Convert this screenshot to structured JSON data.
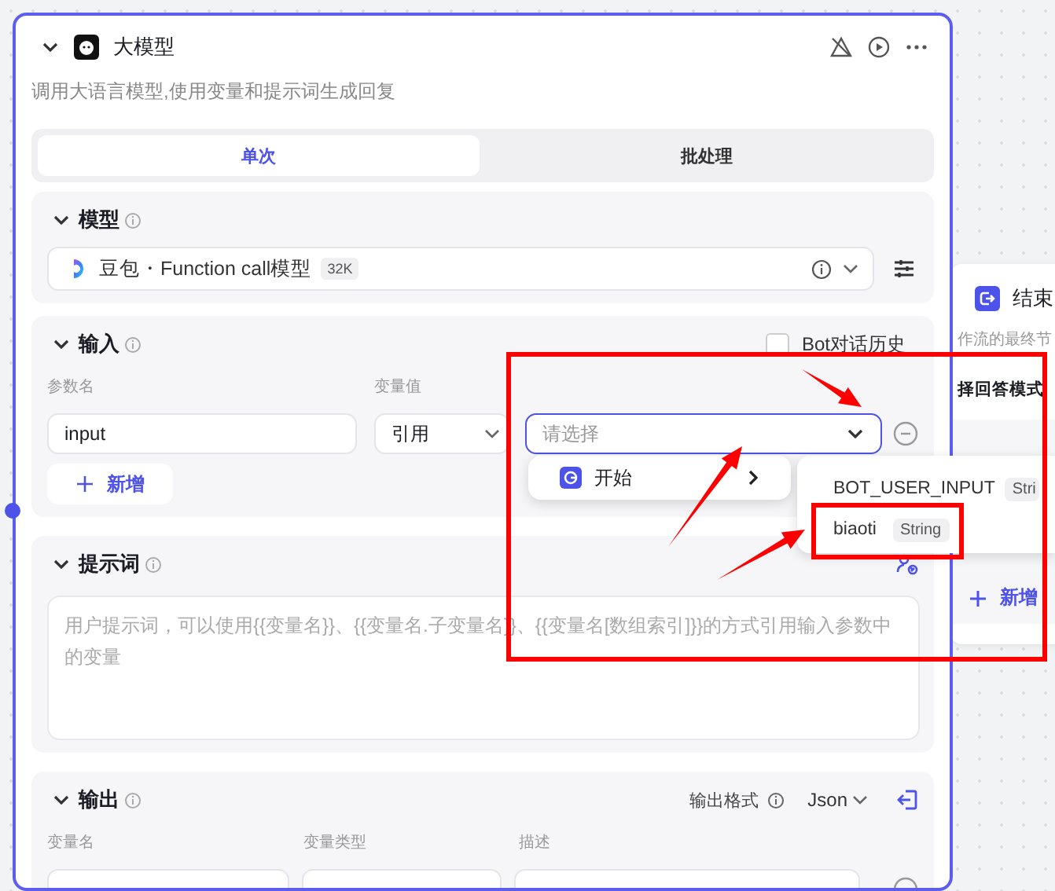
{
  "node": {
    "title": "大模型",
    "description": "调用大语言模型,使用变量和提示词生成回复",
    "tabs": [
      {
        "label": "单次",
        "selected": true
      },
      {
        "label": "批处理",
        "selected": false
      }
    ],
    "model_section": {
      "title": "模型",
      "model": "豆包・Function call模型",
      "badge": "32K"
    },
    "input_section": {
      "title": "输入",
      "bot_history": {
        "label": "Bot对话历史",
        "checked": false
      },
      "columns": [
        "参数名",
        "变量值"
      ],
      "params": [
        {
          "name": "input",
          "source": "引用",
          "value_placeholder": "请选择"
        }
      ],
      "add_button": "新增"
    },
    "prompt_section": {
      "title": "提示词",
      "placeholder": "用户提示词，可以使用{{变量名}}、{{变量名.子变量名}}、{{变量名[数组索引]}}的方式引用输入参数中的变量"
    },
    "output_section": {
      "title": "输出",
      "format_label": "输出格式",
      "format": "Json",
      "columns": [
        "变量名",
        "变量类型",
        "描述"
      ]
    }
  },
  "dropdown": {
    "items": [
      {
        "label": "开始"
      }
    ],
    "submenu": [
      {
        "name": "BOT_USER_INPUT",
        "type": "Stri"
      },
      {
        "name": "biaoti",
        "type": "String"
      }
    ]
  },
  "end_node": {
    "title": "结束",
    "description": "作流的最终节",
    "answer_mode_label": "择回答模式",
    "add_button": "新增"
  }
}
